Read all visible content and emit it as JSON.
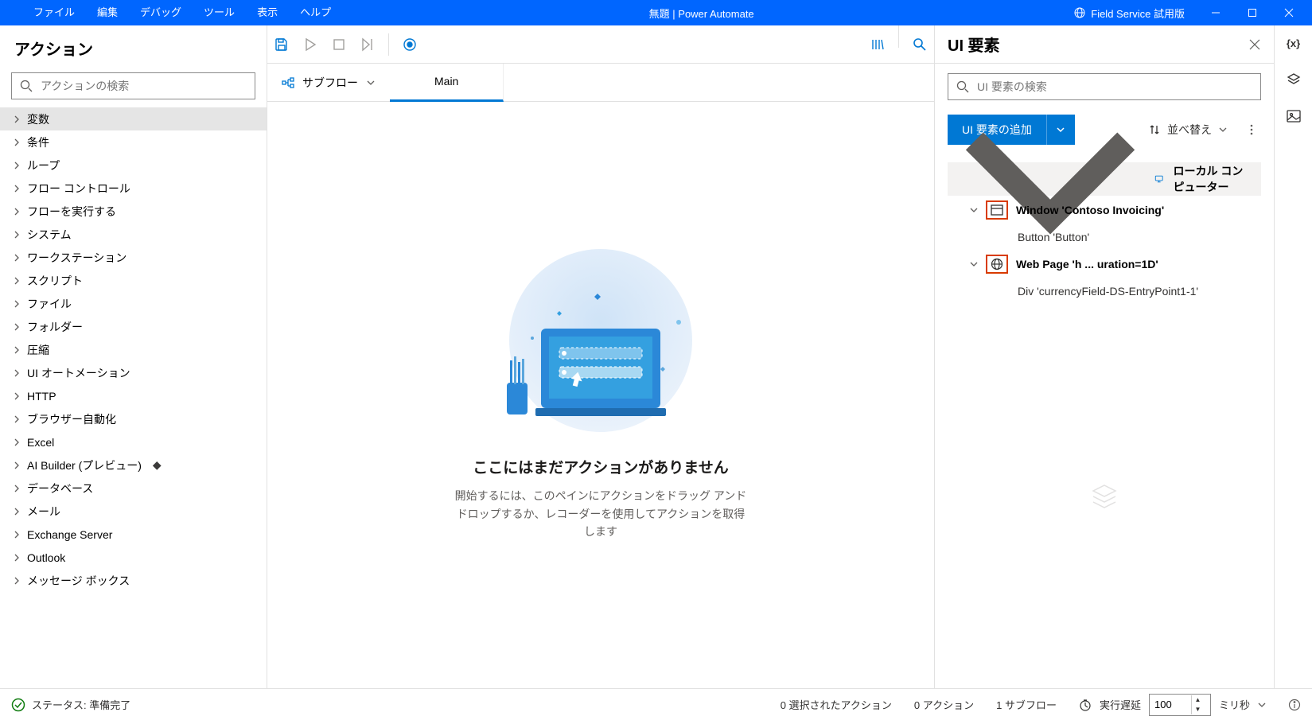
{
  "titlebar": {
    "menu": [
      "ファイル",
      "編集",
      "デバッグ",
      "ツール",
      "表示",
      "ヘルプ"
    ],
    "title": "無題 | Power Automate",
    "trial": "Field Service 試用版"
  },
  "actions": {
    "header": "アクション",
    "search_placeholder": "アクションの検索",
    "items": [
      {
        "label": "変数",
        "selected": true
      },
      {
        "label": "条件"
      },
      {
        "label": "ループ"
      },
      {
        "label": "フロー コントロール"
      },
      {
        "label": "フローを実行する"
      },
      {
        "label": "システム"
      },
      {
        "label": "ワークステーション"
      },
      {
        "label": "スクリプト"
      },
      {
        "label": "ファイル"
      },
      {
        "label": "フォルダー"
      },
      {
        "label": "圧縮"
      },
      {
        "label": "UI オートメーション"
      },
      {
        "label": "HTTP"
      },
      {
        "label": "ブラウザー自動化"
      },
      {
        "label": "Excel"
      },
      {
        "label": "AI Builder (プレビュー)",
        "diamond": true
      },
      {
        "label": "データベース"
      },
      {
        "label": "メール"
      },
      {
        "label": "Exchange Server"
      },
      {
        "label": "Outlook"
      },
      {
        "label": "メッセージ ボックス"
      }
    ]
  },
  "subflow": {
    "label": "サブフロー",
    "main_tab": "Main"
  },
  "canvas": {
    "title": "ここにはまだアクションがありません",
    "subtitle": "開始するには、このペインにアクションをドラッグ アンド ドロップするか、レコーダーを使用してアクションを取得します"
  },
  "ui_panel": {
    "header": "UI 要素",
    "search_placeholder": "UI 要素の検索",
    "add_button": "UI 要素の追加",
    "sort_label": "並べ替え",
    "tree": {
      "root": "ローカル コンピューター",
      "window": {
        "label": "Window 'Contoso Invoicing'",
        "child": "Button 'Button'"
      },
      "webpage": {
        "label": "Web Page 'h ... uration=1D'",
        "child": "Div 'currencyField-DS-EntryPoint1-1'"
      }
    }
  },
  "statusbar": {
    "status": "ステータス: 準備完了",
    "selected": "0 選択されたアクション",
    "actions": "0 アクション",
    "subflows": "1 サブフロー",
    "delay_label": "実行遅延",
    "delay_value": "100",
    "delay_unit": "ミリ秒"
  }
}
